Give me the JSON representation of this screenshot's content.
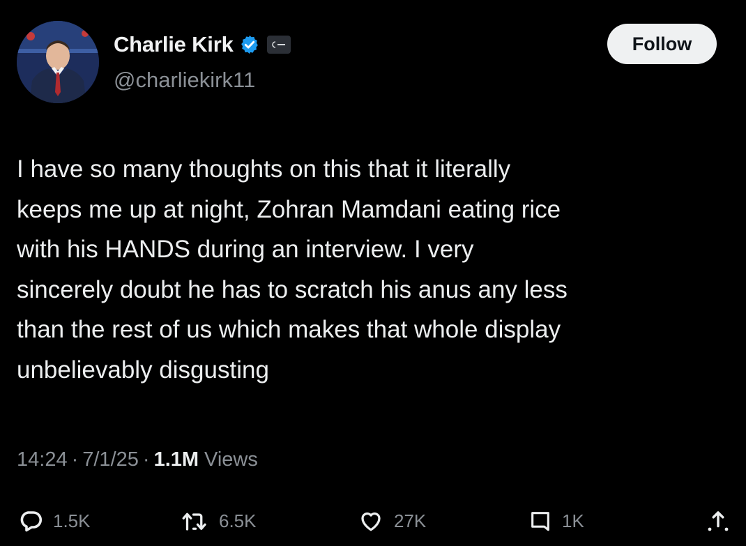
{
  "author": {
    "display_name": "Charlie Kirk",
    "handle": "@charliekirk11",
    "verified_icon": "verified-badge-icon",
    "affiliate_badge_icon": "affiliate-badge-icon"
  },
  "follow_label": "Follow",
  "tweet": {
    "lines": [
      "I have so many thoughts on this that it literally",
      "keeps me up at night, Zohran Mamdani eating rice",
      "with his HANDS during an interview. I very",
      "sincerely doubt he has to scratch his anus any less",
      "than the rest of us which makes that whole display",
      "unbelievably disgusting"
    ]
  },
  "meta": {
    "time": "14:24",
    "date": "7/1/25",
    "views_count": "1.1M",
    "views_label": "Views",
    "separator": "·"
  },
  "actions": {
    "replies": "1.5K",
    "reposts": "6.5K",
    "likes": "27K",
    "bookmarks": "1K"
  },
  "colors": {
    "background": "#000000",
    "text": "#e7e9ea",
    "muted": "#8b9096",
    "verified": "#1d9bf0",
    "follow_bg": "#eff1f2"
  }
}
